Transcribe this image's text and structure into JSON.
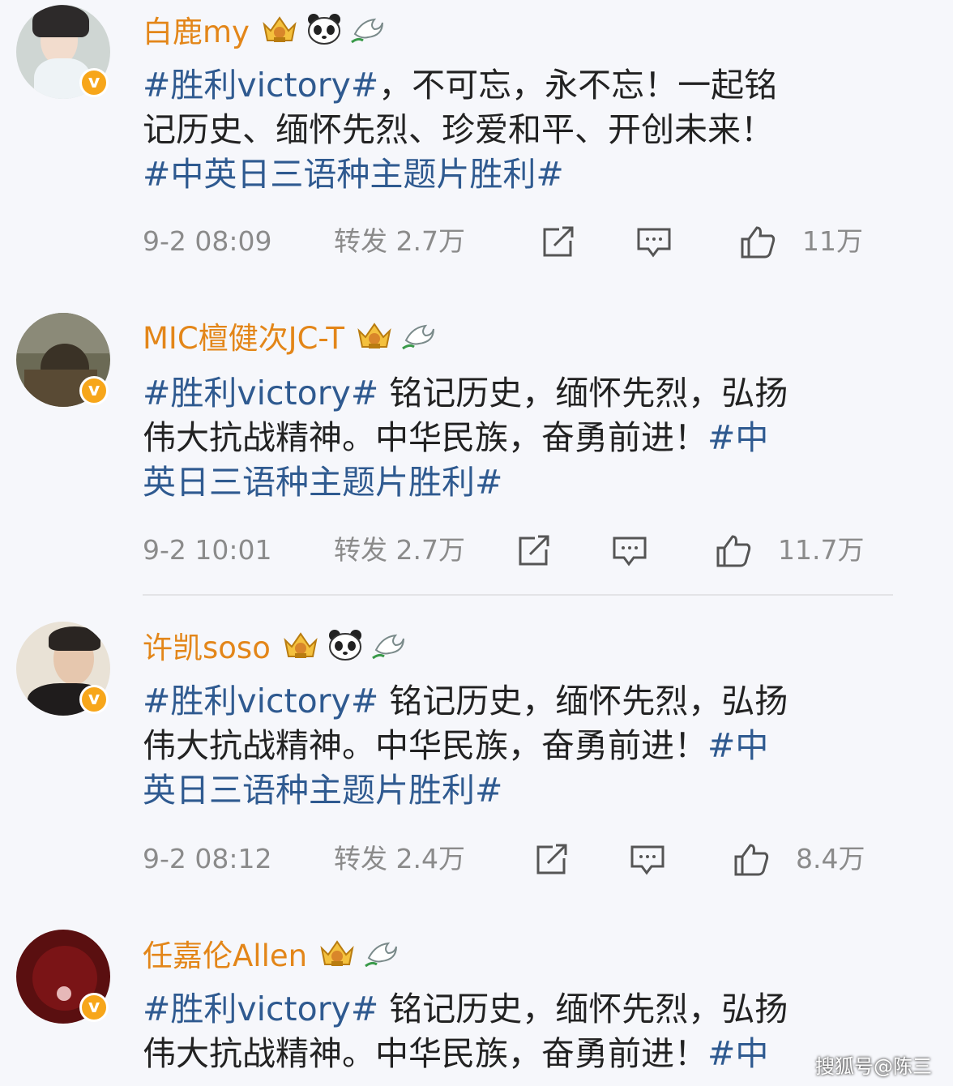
{
  "posts": [
    {
      "username": "白鹿my",
      "content": [
        "#胜利victory#，不可忘，永不忘！一起铭",
        "记历史、缅怀先烈、珍爱和平、开创未来！",
        "#中英日三语种主题片胜利#"
      ],
      "time": "9-2 08:09",
      "repost": "转发 2.7万",
      "likes": "11万"
    },
    {
      "username": "MIC檀健次JC-T",
      "content": [
        "#胜利victory# 铭记历史，缅怀先烈，弘扬",
        "伟大抗战精神。中华民族，奋勇前进！#中",
        "英日三语种主题片胜利#"
      ],
      "time": "9-2 10:01",
      "repost": "转发 2.7万",
      "likes": "11.7万"
    },
    {
      "username": "许凯soso",
      "content": [
        "#胜利victory# 铭记历史，缅怀先烈，弘扬",
        "伟大抗战精神。中华民族，奋勇前进！#中",
        "英日三语种主题片胜利#"
      ],
      "time": "9-2 08:12",
      "repost": "转发 2.4万",
      "likes": "8.4万"
    },
    {
      "username": "任嘉伦Allen",
      "content": [
        "#胜利victory# 铭记历史，缅怀先烈，弘扬",
        "伟大抗战精神。中华民族，奋勇前进！#中"
      ]
    }
  ],
  "watermark": "搜狐号@陈三",
  "colors": {
    "username": "#e38619",
    "hashtag": "#2f5a90",
    "meta": "#8b8b8b",
    "verified": "#f7a61a"
  }
}
